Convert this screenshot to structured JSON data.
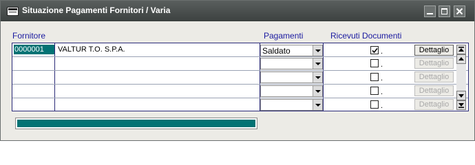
{
  "window": {
    "title": "Situazione Pagamenti Fornitori / Varia"
  },
  "columns": {
    "fornitore": "Fornitore",
    "pagamenti": "Pagamenti",
    "ricevuti": "Ricevuti Documenti"
  },
  "rows": [
    {
      "code": "0000001",
      "name": "VALTUR T.O. S.P.A.",
      "pagamento": "Saldato",
      "ricevuti": true,
      "dot": ".",
      "dettaglio": "Dettaglio",
      "enabled": true
    },
    {
      "code": "",
      "name": "",
      "pagamento": "",
      "ricevuti": false,
      "dot": ".",
      "dettaglio": "Dettaglio",
      "enabled": false
    },
    {
      "code": "",
      "name": "",
      "pagamento": "",
      "ricevuti": false,
      "dot": ".",
      "dettaglio": "Dettaglio",
      "enabled": false
    },
    {
      "code": "",
      "name": "",
      "pagamento": "",
      "ricevuti": false,
      "dot": ".",
      "dettaglio": "Dettaglio",
      "enabled": false
    },
    {
      "code": "",
      "name": "",
      "pagamento": "",
      "ricevuti": false,
      "dot": ".",
      "dettaglio": "Dettaglio",
      "enabled": false
    }
  ],
  "progress": {
    "value": 1.0
  },
  "colors": {
    "accent": "#037374",
    "titlebar": "#4a4f4e",
    "header_text": "#1a1aa0"
  }
}
